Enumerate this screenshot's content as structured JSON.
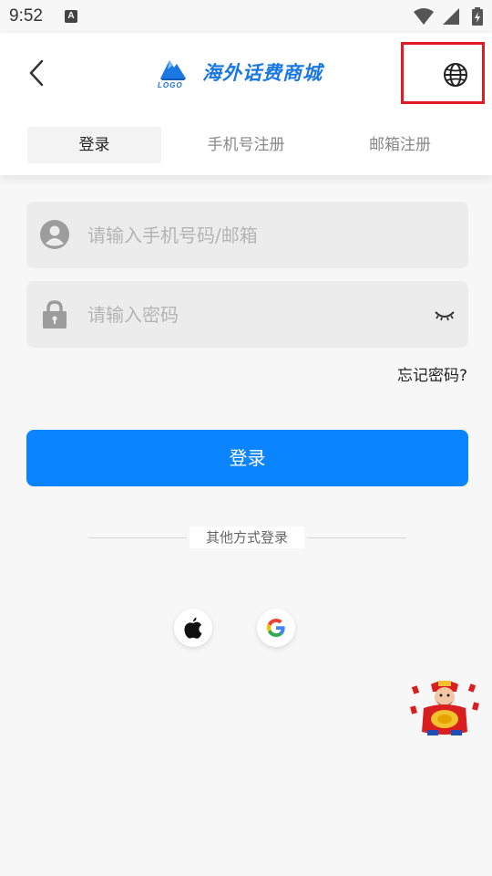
{
  "status_bar": {
    "time": "9:52",
    "notification_icon": "A",
    "icons": [
      "wifi-icon",
      "signal-icon",
      "battery-charging-icon"
    ]
  },
  "header": {
    "back_icon": "chevron-left-icon",
    "logo_small": "LOGO",
    "title": "海外话费商城",
    "language_icon": "globe-icon"
  },
  "tabs": [
    {
      "label": "登录",
      "active": true
    },
    {
      "label": "手机号注册",
      "active": false
    },
    {
      "label": "邮箱注册",
      "active": false
    }
  ],
  "form": {
    "account": {
      "placeholder": "请输入手机号码/邮箱",
      "value": "",
      "icon": "user-icon"
    },
    "password": {
      "placeholder": "请输入密码",
      "value": "",
      "icon": "lock-icon",
      "toggle_icon": "eye-closed-icon"
    },
    "forgot_label": "忘记密码?",
    "submit_label": "登录"
  },
  "other_login": {
    "label": "其他方式登录",
    "providers": [
      "apple-icon",
      "google-icon"
    ]
  },
  "colors": {
    "primary": "#0a84ff",
    "logo_blue": "#1a78e0",
    "highlight_red": "#e01b24"
  }
}
